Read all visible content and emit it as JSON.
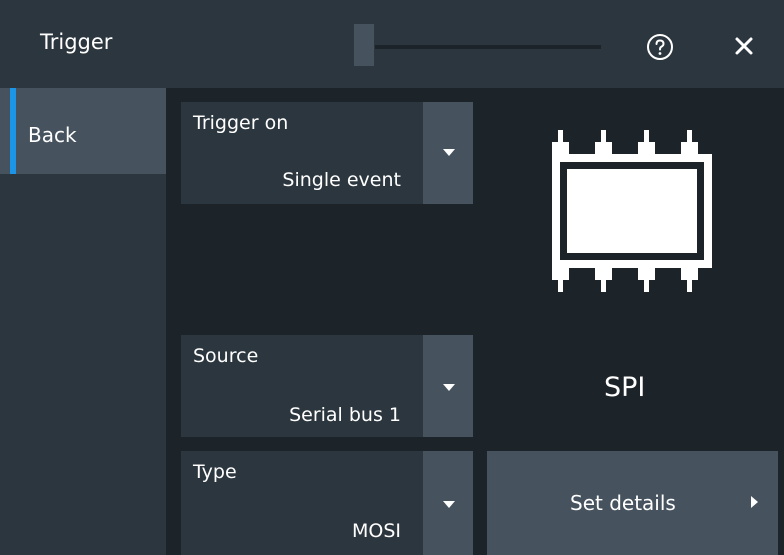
{
  "window": {
    "title": "Trigger",
    "help_icon": "help-circle-icon",
    "close_icon": "close-icon"
  },
  "sidebar": {
    "back_label": "Back"
  },
  "trigger_on": {
    "label": "Trigger on",
    "value": "Single event"
  },
  "source": {
    "label": "Source",
    "value": "Serial bus 1"
  },
  "type": {
    "label": "Type",
    "value": "MOSI"
  },
  "protocol": {
    "icon": "chip-icon",
    "label": "SPI"
  },
  "details_button": {
    "label": "Set details"
  },
  "colors": {
    "background": "#1c2329",
    "panel": "#2c363e",
    "button": "#46535e",
    "accent": "#1c95e6"
  }
}
